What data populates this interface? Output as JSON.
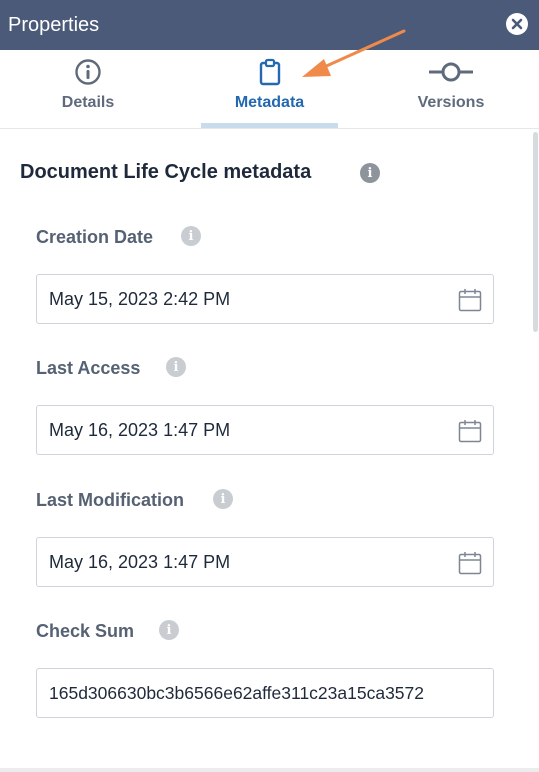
{
  "window": {
    "title": "Properties",
    "close_icon": "close-icon"
  },
  "tabs": [
    {
      "label": "Details",
      "icon": "info-circle-icon",
      "active": false
    },
    {
      "label": "Metadata",
      "icon": "clipboard-icon",
      "active": true
    },
    {
      "label": "Versions",
      "icon": "version-line-icon",
      "active": false
    }
  ],
  "section": {
    "title": "Document Life Cycle metadata",
    "icon": "info-icon"
  },
  "fields": [
    {
      "label": "Creation Date",
      "value": "May 15, 2023 2:42 PM",
      "icon": "calendar-icon"
    },
    {
      "label": "Last Access",
      "value": "May 16, 2023 1:47 PM",
      "icon": "calendar-icon"
    },
    {
      "label": "Last Modification",
      "value": "May 16, 2023 1:47 PM",
      "icon": "calendar-icon"
    },
    {
      "label": "Check Sum",
      "value": "165d306630bc3b6566e62affe311c23a15ca3572"
    }
  ],
  "colors": {
    "header_bg": "#4a5a78",
    "accent": "#2368b0",
    "arrow": "#f08a4b"
  }
}
